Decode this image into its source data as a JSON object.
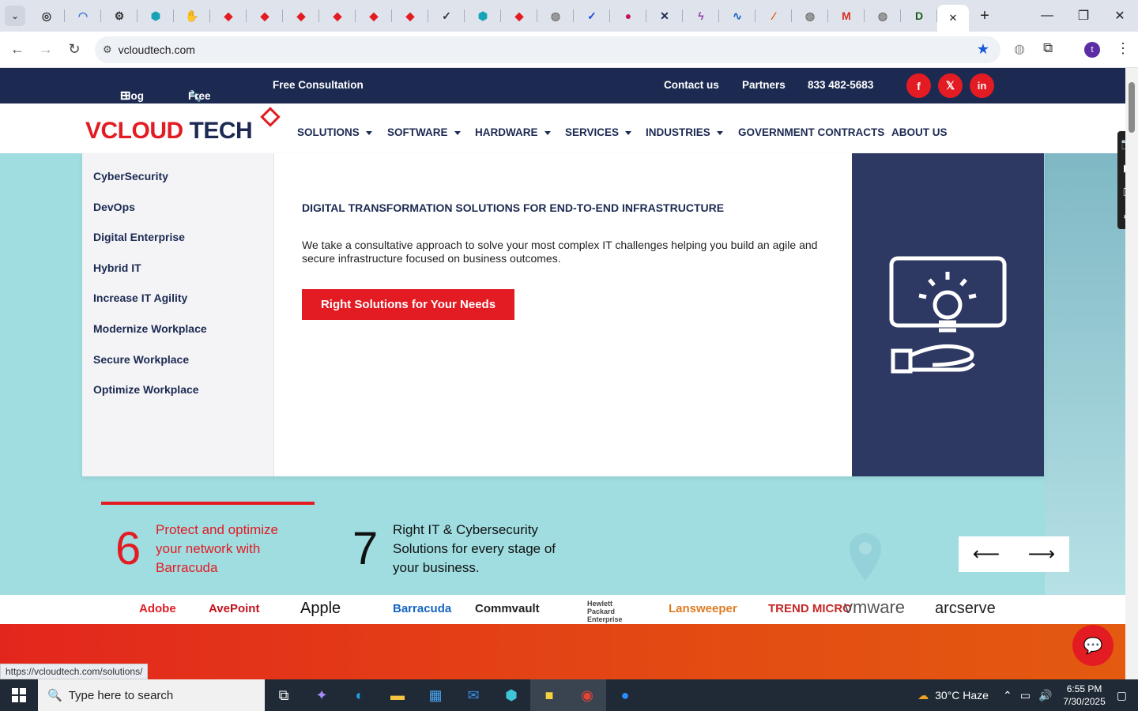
{
  "browser": {
    "tabs": [
      {
        "icon": "target-icon",
        "color": "#333"
      },
      {
        "icon": "wave-icon",
        "color": "#3a6fd8"
      },
      {
        "icon": "openai-icon",
        "color": "#333"
      },
      {
        "icon": "hex-icon",
        "color": "#16a3b6"
      },
      {
        "icon": "hand-icon",
        "color": "#e07030"
      },
      {
        "icon": "diamond-icon",
        "color": "#e31b23"
      },
      {
        "icon": "diamond-icon",
        "color": "#e31b23"
      },
      {
        "icon": "diamond-icon",
        "color": "#e31b23"
      },
      {
        "icon": "diamond-icon",
        "color": "#e31b23"
      },
      {
        "icon": "diamond-icon",
        "color": "#e31b23"
      },
      {
        "icon": "diamond-icon",
        "color": "#e31b23"
      },
      {
        "icon": "check-icon",
        "color": "#333"
      },
      {
        "icon": "hex-icon",
        "color": "#16a3b6"
      },
      {
        "icon": "diamond-icon",
        "color": "#e31b23"
      },
      {
        "icon": "globe-icon",
        "color": "#777"
      },
      {
        "icon": "check-icon",
        "color": "#1c4fd8"
      },
      {
        "icon": "ball-icon",
        "color": "#c2185b"
      },
      {
        "icon": "x-icon",
        "color": "#1c2a52"
      },
      {
        "icon": "lightning-icon",
        "color": "#8e44ad"
      },
      {
        "icon": "pulse-icon",
        "color": "#1565c0"
      },
      {
        "icon": "swoosh-icon",
        "color": "#e65100"
      },
      {
        "icon": "globe-icon",
        "color": "#777"
      },
      {
        "icon": "gmail-icon",
        "color": "#d93025"
      },
      {
        "icon": "globe-icon",
        "color": "#777"
      },
      {
        "icon": "d-icon",
        "color": "#1b5e20"
      }
    ],
    "active_tab_close": "✕",
    "new_tab": "+",
    "url": "vcloudtech.com",
    "status_url": "https://vcloudtech.com/solutions/"
  },
  "site": {
    "topbar": {
      "blog": "Blog",
      "free_tools": "Free Tools",
      "free_consultation": "Free Consultation",
      "contact": "Contact us",
      "partners": "Partners",
      "phone": "833 482-5683",
      "social": [
        "f",
        "𝕏",
        "in"
      ]
    },
    "logo": {
      "v": "V",
      "cloud": "CLOUD",
      "tech": " TECH"
    },
    "nav": [
      {
        "label": "SOLUTIONS",
        "caret": true
      },
      {
        "label": "SOFTWARE",
        "caret": true
      },
      {
        "label": "HARDWARE",
        "caret": true
      },
      {
        "label": "SERVICES",
        "caret": true
      },
      {
        "label": "INDUSTRIES",
        "caret": true
      },
      {
        "label": "GOVERNMENT CONTRACTS",
        "caret": false
      },
      {
        "label": "ABOUT US",
        "caret": false
      }
    ],
    "mega": {
      "items": [
        "CyberSecurity",
        "DevOps",
        "Digital Enterprise",
        "Hybrid IT",
        "Increase IT Agility",
        "Modernize Workplace",
        "Secure Workplace",
        "Optimize Workplace"
      ],
      "title": "DIGITAL TRANSFORMATION SOLUTIONS FOR END-TO-END INFRASTRUCTURE",
      "description": "We take a consultative approach to solve your most complex IT challenges helping you build an agile and secure infrastructure focused on business outcomes.",
      "cta": "Right Solutions for Your Needs"
    },
    "slides": [
      {
        "number": "6",
        "text": "Protect and optimize your network with Barracuda",
        "color": "#e31b23"
      },
      {
        "number": "7",
        "text": "Right IT & Cybersecurity Solutions for every stage of your business.",
        "color": "#111111"
      }
    ],
    "arrows": {
      "prev": "⟵",
      "next": "⟶"
    },
    "brands": [
      "Adobe",
      "AvePoint",
      "Apple",
      "Barracuda",
      "Commvault",
      "Hewlett Packard Enterprise",
      "Lansweeper",
      "TREND MICRO",
      "vmware",
      "arcserve"
    ]
  },
  "taskbar": {
    "search_placeholder": "Type here to search",
    "weather": "30°C  Haze",
    "time": "6:55 PM",
    "date": "7/30/2025"
  }
}
